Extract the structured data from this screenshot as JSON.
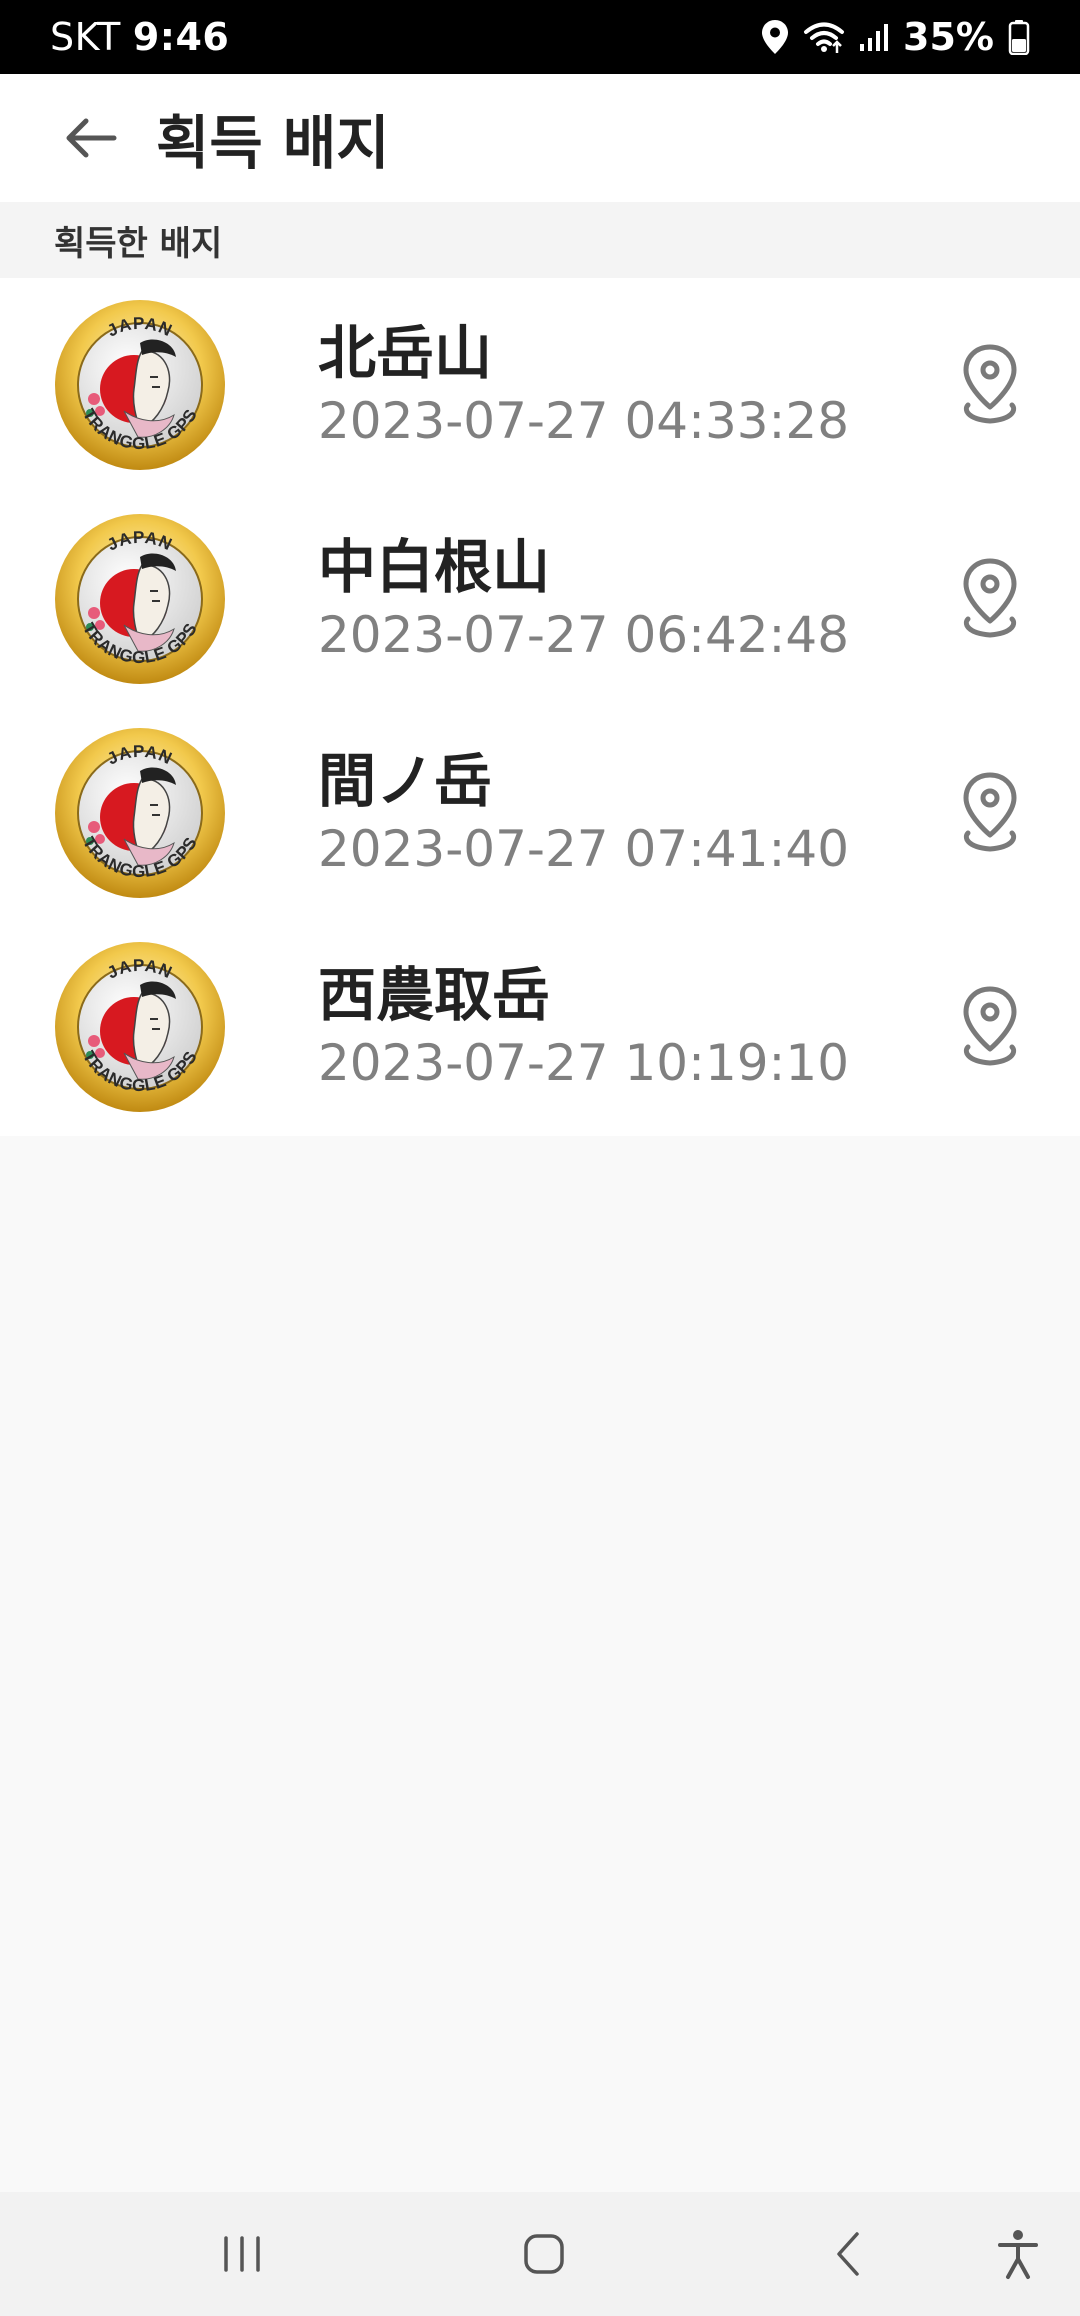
{
  "status_bar": {
    "carrier": "SKT",
    "time": "9:46",
    "battery": "35%"
  },
  "app_bar": {
    "title": "획득 배지"
  },
  "section": {
    "header": "획득한 배지"
  },
  "badge_logo": {
    "top_text": "JAPAN",
    "bottom_text": "TRANGGLE GPS"
  },
  "badges": [
    {
      "name": "北岳山",
      "date": "2023-07-27 04:33:28"
    },
    {
      "name": "中白根山",
      "date": "2023-07-27 06:42:48"
    },
    {
      "name": "間ノ岳",
      "date": "2023-07-27 07:41:40"
    },
    {
      "name": "西農取岳",
      "date": "2023-07-27 10:19:10"
    }
  ],
  "colors": {
    "badge_gold": "#e0b030",
    "badge_red": "#d71920",
    "date_gray": "#808080",
    "icon_gray": "#7a7a7a"
  }
}
